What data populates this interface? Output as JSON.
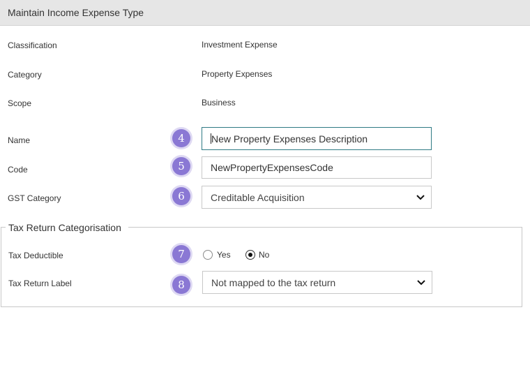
{
  "header": {
    "title": "Maintain Income Expense Type"
  },
  "info": {
    "classification": {
      "label": "Classification",
      "value": "Investment Expense"
    },
    "category": {
      "label": "Category",
      "value": "Property Expenses"
    },
    "scope": {
      "label": "Scope",
      "value": "Business"
    }
  },
  "form": {
    "name": {
      "label": "Name",
      "value": "New Property Expenses Description",
      "badge": "4"
    },
    "code": {
      "label": "Code",
      "value": "NewPropertyExpensesCode",
      "badge": "5"
    },
    "gst": {
      "label": "GST Category",
      "selected": "Creditable Acquisition",
      "badge": "6"
    }
  },
  "tax": {
    "legend": "Tax Return Categorisation",
    "deductible": {
      "label": "Tax Deductible",
      "badge": "7",
      "yes_label": "Yes",
      "no_label": "No",
      "selected": "No"
    },
    "return_label": {
      "label": "Tax Return Label",
      "badge": "8",
      "selected": "Not mapped to the tax return"
    }
  },
  "colors": {
    "badge": "#8a78d4",
    "focus_border": "#2f7a84",
    "header_bg": "#e6e6e6"
  },
  "icons": {
    "select": "chevron-down-icon"
  }
}
